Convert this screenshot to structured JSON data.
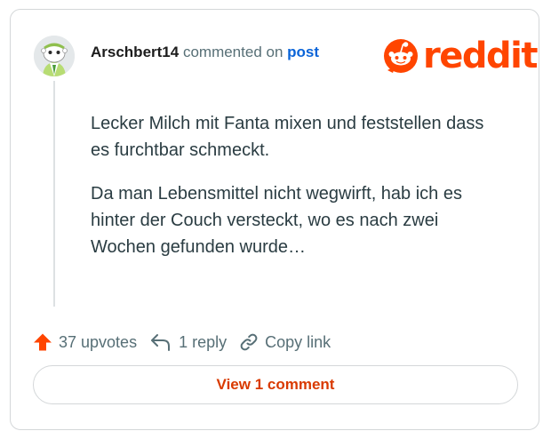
{
  "comment": {
    "author": "Arschbert14",
    "action_text": "commented on",
    "post_link": "post",
    "paragraphs": [
      "Lecker Milch mit Fanta mixen und feststellen dass es furchtbar schmeckt.",
      "Da man Lebensmittel nicht wegwirft, hab ich es hinter der Couch versteckt, wo es nach zwei Wochen gefunden wurde…"
    ]
  },
  "brand": {
    "name": "reddit",
    "icon": "reddit-snoo-icon",
    "color": "#ff4500"
  },
  "actions": {
    "upvotes": "37 upvotes",
    "reply": "1 reply",
    "copy_link": "Copy link"
  },
  "footer": {
    "view_comment": "View 1 comment"
  },
  "colors": {
    "accent": "#ff4500",
    "link": "#0a64d8",
    "muted": "#576f76",
    "button_text": "#d93a00"
  }
}
